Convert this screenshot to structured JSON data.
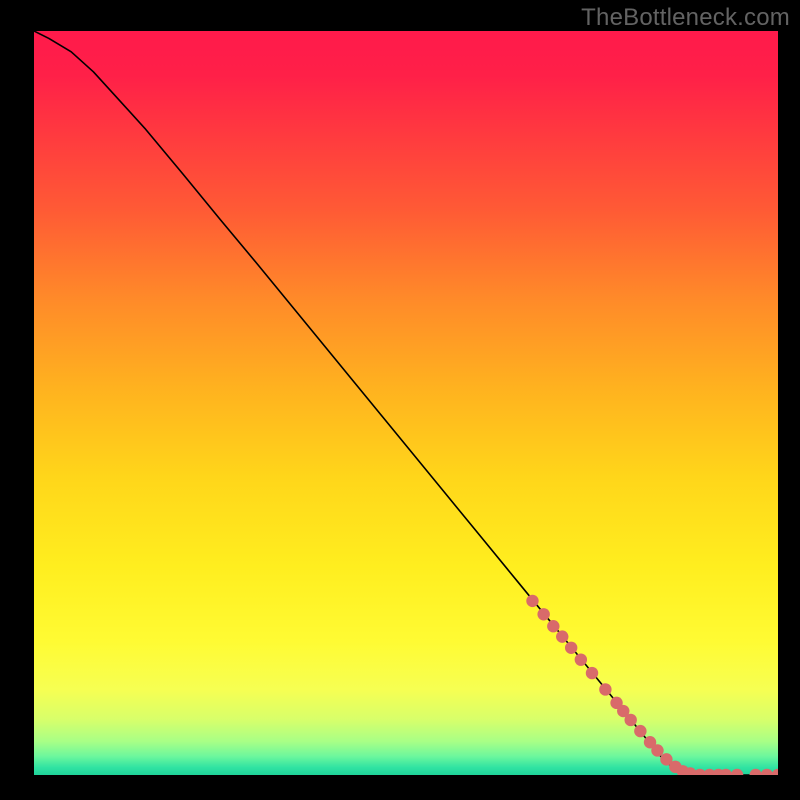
{
  "watermark": "TheBottleneck.com",
  "chart_data": {
    "type": "line",
    "title": "",
    "xlabel": "",
    "ylabel": "",
    "xlim": [
      0,
      100
    ],
    "ylim": [
      0,
      100
    ],
    "grid": false,
    "legend": false,
    "background_gradient_stops": [
      {
        "offset": 0.0,
        "color": "#ff1a4b"
      },
      {
        "offset": 0.06,
        "color": "#ff2048"
      },
      {
        "offset": 0.14,
        "color": "#ff3a3f"
      },
      {
        "offset": 0.24,
        "color": "#ff5a35"
      },
      {
        "offset": 0.36,
        "color": "#ff8a29"
      },
      {
        "offset": 0.48,
        "color": "#ffb21f"
      },
      {
        "offset": 0.6,
        "color": "#ffd61a"
      },
      {
        "offset": 0.72,
        "color": "#ffee1f"
      },
      {
        "offset": 0.82,
        "color": "#fffb33"
      },
      {
        "offset": 0.885,
        "color": "#f6ff52"
      },
      {
        "offset": 0.925,
        "color": "#d8ff6a"
      },
      {
        "offset": 0.955,
        "color": "#a8ff86"
      },
      {
        "offset": 0.975,
        "color": "#6cf79d"
      },
      {
        "offset": 0.99,
        "color": "#30e3a2"
      },
      {
        "offset": 1.0,
        "color": "#1fd39a"
      }
    ],
    "series": [
      {
        "name": "curve",
        "stroke": "#000000",
        "stroke_width": 1.6,
        "x": [
          0,
          2,
          5,
          8,
          11,
          15,
          20,
          25,
          30,
          35,
          40,
          45,
          50,
          55,
          60,
          65,
          70,
          75,
          80,
          83,
          85,
          88,
          90,
          92,
          95,
          100
        ],
        "y": [
          100,
          99.0,
          97.2,
          94.5,
          91.2,
          86.8,
          80.8,
          74.7,
          68.7,
          62.6,
          56.5,
          50.4,
          44.3,
          38.2,
          32.1,
          26.0,
          19.9,
          13.8,
          7.7,
          4.0,
          1.6,
          0.2,
          0,
          0,
          0,
          0
        ]
      }
    ],
    "markers": {
      "name": "highlighted-points",
      "color": "#d96a6a",
      "radius": 6.2,
      "x": [
        67.0,
        68.5,
        69.8,
        71.0,
        72.2,
        73.5,
        75.0,
        76.8,
        78.3,
        79.2,
        80.2,
        81.5,
        82.8,
        83.8,
        85.0,
        86.2,
        87.2,
        88.2,
        89.5,
        90.8,
        92.0,
        93.0,
        94.5,
        97.0,
        98.5,
        100.0
      ],
      "y": [
        23.4,
        21.6,
        20.0,
        18.6,
        17.1,
        15.5,
        13.7,
        11.5,
        9.7,
        8.6,
        7.4,
        5.9,
        4.4,
        3.3,
        2.1,
        1.1,
        0.5,
        0.2,
        0.0,
        0.0,
        0.0,
        0.0,
        0.0,
        0.0,
        0.0,
        0.0
      ]
    }
  }
}
